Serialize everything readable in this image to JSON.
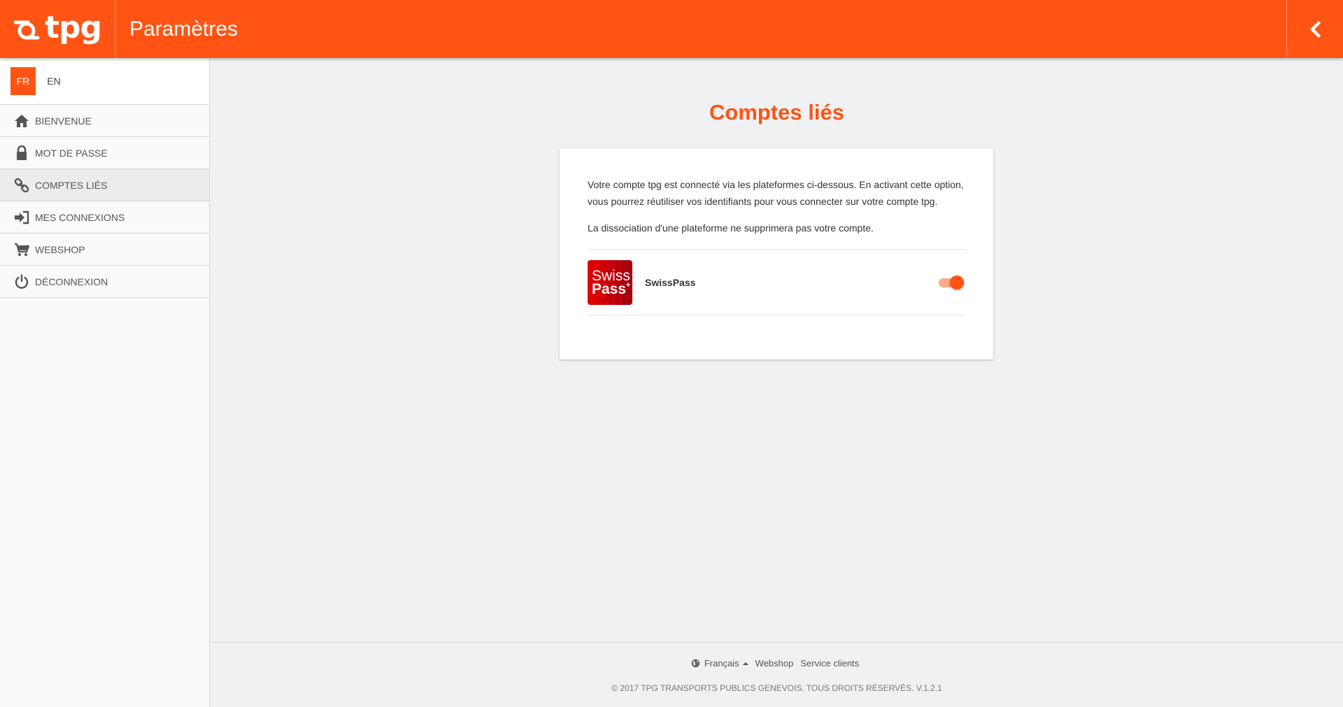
{
  "header": {
    "logo_text": "tpg",
    "title": "Paramètres",
    "back_icon": "chevron-left-icon"
  },
  "colors": {
    "accent": "#ff5414",
    "sidebar_bg": "#fafafa",
    "main_bg": "#f0f1f3"
  },
  "sidebar": {
    "languages": [
      {
        "code": "FR",
        "active": true
      },
      {
        "code": "EN",
        "active": false
      }
    ],
    "items": [
      {
        "label": "BIENVENUE",
        "icon": "home-icon"
      },
      {
        "label": "MOT DE PASSE",
        "icon": "lock-icon"
      },
      {
        "label": "COMPTES LIÉS",
        "icon": "link-icon",
        "active": true
      },
      {
        "label": "MES CONNEXIONS",
        "icon": "sign-in-icon"
      },
      {
        "label": "WEBSHOP",
        "icon": "cart-icon"
      },
      {
        "label": "DÉCONNEXION",
        "icon": "power-icon"
      }
    ]
  },
  "main": {
    "title": "Comptes liés",
    "intro": "Votre compte tpg est connecté via les plateformes ci-dessous. En activant cette option, vous pourrez réutiliser vos identifiants pour vous connecter sur votre compte tpg.",
    "note": "La dissociation d'une plateforme ne supprimera pas votre compte.",
    "accounts": [
      {
        "name": "SwissPass",
        "logo_line1": "Swiss",
        "logo_line2": "Pass",
        "logo_plus": "+",
        "enabled": true
      }
    ]
  },
  "footer": {
    "language": "Français",
    "language_icon": "globe-icon",
    "links": [
      "Webshop",
      "Service clients"
    ],
    "copyright": "© 2017 TPG TRANSPORTS PUBLICS GENEVOIS. TOUS DROITS RÉSERVÉS. V.1.2.1"
  }
}
